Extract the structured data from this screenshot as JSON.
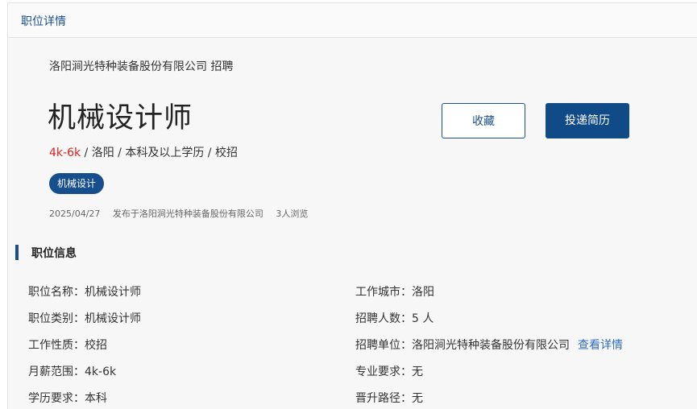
{
  "header": {
    "title": "职位详情"
  },
  "job": {
    "company_line": "洛阳涧光特种装备股份有限公司 招聘",
    "title": "机械设计师",
    "salary": "4k-6k",
    "meta_rest": " / 洛阳 / 本科及以上学历 / 校招",
    "tag": "机械设计",
    "posted_date": "2025/04/27",
    "posted_by": "发布于洛阳涧光特种装备股份有限公司",
    "views": "3人浏览"
  },
  "actions": {
    "favorite": "收藏",
    "apply": "投递简历"
  },
  "info": {
    "section_title": "职位信息",
    "left": [
      {
        "label": "职位名称：",
        "value": "机械设计师"
      },
      {
        "label": "职位类别：",
        "value": "机械设计师"
      },
      {
        "label": "工作性质：",
        "value": "校招"
      },
      {
        "label": "月薪范围：",
        "value": "4k-6k"
      },
      {
        "label": "学历要求：",
        "value": "本科"
      }
    ],
    "right": [
      {
        "label": "工作城市：",
        "value": "洛阳"
      },
      {
        "label": "招聘人数：",
        "value": "5 人"
      },
      {
        "label": "招聘单位：",
        "value": "洛阳涧光特种装备股份有限公司",
        "link": "查看详情"
      },
      {
        "label": "专业要求：",
        "value": "无"
      },
      {
        "label": "晋升路径：",
        "value": "无"
      }
    ]
  },
  "colors": {
    "accent": "#1a4f8b",
    "salary": "#e02020",
    "link": "#2d6cc0"
  }
}
